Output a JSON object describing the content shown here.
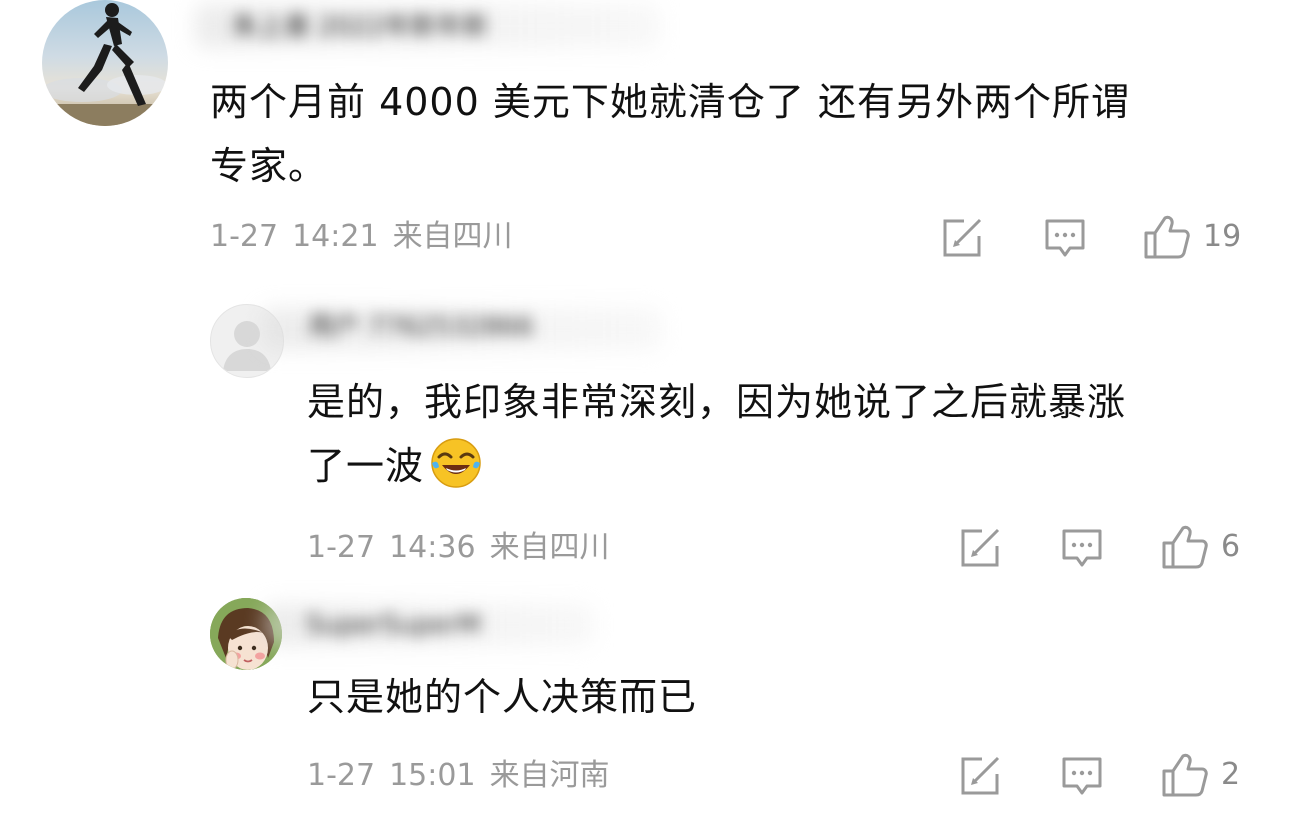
{
  "comments": [
    {
      "username": "朱上善 2022年新年新",
      "content_line1": "两个月前 4000 美元下她就清仓了 还有另外两个所谓",
      "content_line2": "专家。",
      "date": "1-27",
      "time": "14:21",
      "location": "来自四川",
      "likes": "19",
      "avatar_icon": "runner-silhouette-avatar"
    },
    {
      "username": "用户 7762532866",
      "content_line1": "是的，我印象非常深刻，因为她说了之后就暴涨",
      "content_line2": "了一波",
      "emoji": "laughing-crying-emoji",
      "date": "1-27",
      "time": "14:36",
      "location": "来自四川",
      "likes": "6",
      "avatar_icon": "default-user-avatar"
    },
    {
      "username": "SuperSuperM",
      "content_line1": "只是她的个人决策而已",
      "date": "1-27",
      "time": "15:01",
      "location": "来自河南",
      "likes": "2",
      "avatar_icon": "cartoon-girl-avatar"
    }
  ],
  "actions": {
    "share_icon": "share-edit-icon",
    "reply_icon": "comment-bubble-icon",
    "like_icon": "thumbs-up-icon"
  },
  "colors": {
    "text": "#111111",
    "meta": "#9a9a9a",
    "icon": "#9a9a9a"
  }
}
